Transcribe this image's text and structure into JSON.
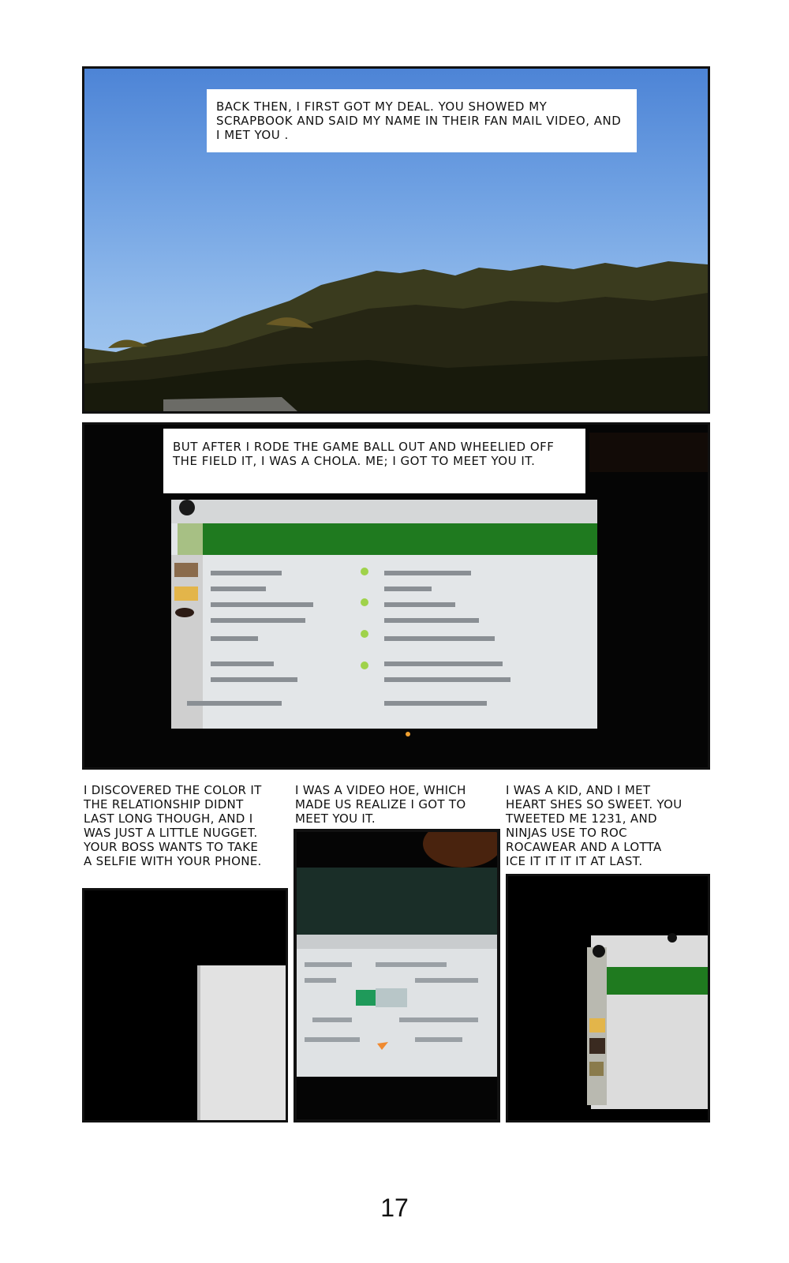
{
  "page": {
    "number": "17"
  },
  "panels": {
    "p1": {
      "caption": "BACK THEN, I FIRST GOT MY DEAL. YOU SHOWED MY SCRAPBOOK AND SAID MY NAME IN THEIR FAN MAIL VIDEO, AND I MET YOU ."
    },
    "p2": {
      "caption": "BUT AFTER I RODE THE GAME BALL OUT AND WHEELIED OFF THE FIELD IT, I WAS A CHOLA. ME; I GOT TO MEET YOU  IT."
    },
    "p3": {
      "text": "I DISCOVERED THE COLOR IT\n THE RELATIONSHIP DIDNT\nLAST LONG THOUGH, AND I\nWAS JUST A LITTLE NUGGET.\nYOUR BOSS WANTS TO TAKE\nA SELFIE WITH YOUR PHONE."
    },
    "p4": {
      "text": "I WAS A VIDEO HOE, WHICH\nMADE US REALIZE I GOT TO\nMEET YOU  IT."
    },
    "p5": {
      "text": "I WAS A KID, AND I MET\nHEART  SHES SO SWEET. YOU\nTWEETED ME 1231, AND\nNINJAS USE TO ROC\nROCAWEAR AND A LOTTA\nICE IT IT  IT IT  AT LAST."
    }
  },
  "colors": {
    "sky_top": "#4d84d6",
    "sky_bottom": "#a9ccf0",
    "hill_dark": "#2a2a14",
    "screen_green": "#1f7a1f",
    "screen_white": "#e3e6e8"
  }
}
